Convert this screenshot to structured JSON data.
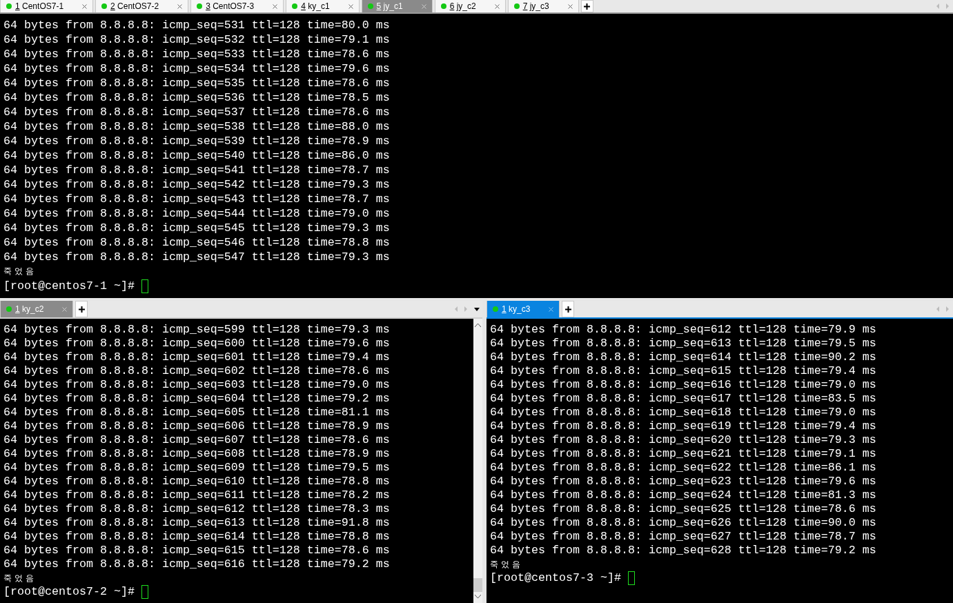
{
  "top_tabs": [
    {
      "number": "1",
      "name": "CentOS7-1",
      "selected": false,
      "connected": true
    },
    {
      "number": "2",
      "name": "CentOS7-2",
      "selected": false,
      "connected": true
    },
    {
      "number": "3",
      "name": "CentOS7-3",
      "selected": false,
      "connected": true
    },
    {
      "number": "4",
      "name": "ky_c1",
      "selected": false,
      "connected": true
    },
    {
      "number": "5",
      "name": "jy_c1",
      "selected": true,
      "connected": true
    },
    {
      "number": "6",
      "name": "jy_c2",
      "selected": false,
      "connected": true
    },
    {
      "number": "7",
      "name": "jy_c3",
      "selected": false,
      "connected": true
    }
  ],
  "top_pane": {
    "lines": [
      {
        "kind": "output",
        "text": "64 bytes from 8.8.8.8: icmp_seq=531 ttl=128 time=80.0 ms"
      },
      {
        "kind": "output",
        "text": "64 bytes from 8.8.8.8: icmp_seq=532 ttl=128 time=79.1 ms"
      },
      {
        "kind": "output",
        "text": "64 bytes from 8.8.8.8: icmp_seq=533 ttl=128 time=78.6 ms"
      },
      {
        "kind": "output",
        "text": "64 bytes from 8.8.8.8: icmp_seq=534 ttl=128 time=79.6 ms"
      },
      {
        "kind": "output",
        "text": "64 bytes from 8.8.8.8: icmp_seq=535 ttl=128 time=78.6 ms"
      },
      {
        "kind": "output",
        "text": "64 bytes from 8.8.8.8: icmp_seq=536 ttl=128 time=78.5 ms"
      },
      {
        "kind": "output",
        "text": "64 bytes from 8.8.8.8: icmp_seq=537 ttl=128 time=78.6 ms"
      },
      {
        "kind": "output",
        "text": "64 bytes from 8.8.8.8: icmp_seq=538 ttl=128 time=88.0 ms"
      },
      {
        "kind": "output",
        "text": "64 bytes from 8.8.8.8: icmp_seq=539 ttl=128 time=78.9 ms"
      },
      {
        "kind": "output",
        "text": "64 bytes from 8.8.8.8: icmp_seq=540 ttl=128 time=86.0 ms"
      },
      {
        "kind": "output",
        "text": "64 bytes from 8.8.8.8: icmp_seq=541 ttl=128 time=78.7 ms"
      },
      {
        "kind": "output",
        "text": "64 bytes from 8.8.8.8: icmp_seq=542 ttl=128 time=79.3 ms"
      },
      {
        "kind": "output",
        "text": "64 bytes from 8.8.8.8: icmp_seq=543 ttl=128 time=78.7 ms"
      },
      {
        "kind": "output",
        "text": "64 bytes from 8.8.8.8: icmp_seq=544 ttl=128 time=79.0 ms"
      },
      {
        "kind": "output",
        "text": "64 bytes from 8.8.8.8: icmp_seq=545 ttl=128 time=79.3 ms"
      },
      {
        "kind": "output",
        "text": "64 bytes from 8.8.8.8: icmp_seq=546 ttl=128 time=78.8 ms"
      },
      {
        "kind": "output",
        "text": "64 bytes from 8.8.8.8: icmp_seq=547 ttl=128 time=79.3 ms"
      },
      {
        "kind": "notice",
        "text": "죽 었 음"
      },
      {
        "kind": "prompt",
        "text": "[root@centos7-1 ~]#"
      }
    ]
  },
  "bottom_left_pane": {
    "active": false,
    "tabs": [
      {
        "number": "1",
        "name": "ky_c2",
        "selected": true,
        "connected": true
      }
    ],
    "lines": [
      {
        "kind": "output",
        "text": "64 bytes from 8.8.8.8: icmp_seq=599 ttl=128 time=79.3 ms"
      },
      {
        "kind": "output",
        "text": "64 bytes from 8.8.8.8: icmp_seq=600 ttl=128 time=79.6 ms"
      },
      {
        "kind": "output",
        "text": "64 bytes from 8.8.8.8: icmp_seq=601 ttl=128 time=79.4 ms"
      },
      {
        "kind": "output",
        "text": "64 bytes from 8.8.8.8: icmp_seq=602 ttl=128 time=78.6 ms"
      },
      {
        "kind": "output",
        "text": "64 bytes from 8.8.8.8: icmp_seq=603 ttl=128 time=79.0 ms"
      },
      {
        "kind": "output",
        "text": "64 bytes from 8.8.8.8: icmp_seq=604 ttl=128 time=79.2 ms"
      },
      {
        "kind": "output",
        "text": "64 bytes from 8.8.8.8: icmp_seq=605 ttl=128 time=81.1 ms"
      },
      {
        "kind": "output",
        "text": "64 bytes from 8.8.8.8: icmp_seq=606 ttl=128 time=78.9 ms"
      },
      {
        "kind": "output",
        "text": "64 bytes from 8.8.8.8: icmp_seq=607 ttl=128 time=78.6 ms"
      },
      {
        "kind": "output",
        "text": "64 bytes from 8.8.8.8: icmp_seq=608 ttl=128 time=78.9 ms"
      },
      {
        "kind": "output",
        "text": "64 bytes from 8.8.8.8: icmp_seq=609 ttl=128 time=79.5 ms"
      },
      {
        "kind": "output",
        "text": "64 bytes from 8.8.8.8: icmp_seq=610 ttl=128 time=78.8 ms"
      },
      {
        "kind": "output",
        "text": "64 bytes from 8.8.8.8: icmp_seq=611 ttl=128 time=78.2 ms"
      },
      {
        "kind": "output",
        "text": "64 bytes from 8.8.8.8: icmp_seq=612 ttl=128 time=78.3 ms"
      },
      {
        "kind": "output",
        "text": "64 bytes from 8.8.8.8: icmp_seq=613 ttl=128 time=91.8 ms"
      },
      {
        "kind": "output",
        "text": "64 bytes from 8.8.8.8: icmp_seq=614 ttl=128 time=78.8 ms"
      },
      {
        "kind": "output",
        "text": "64 bytes from 8.8.8.8: icmp_seq=615 ttl=128 time=78.6 ms"
      },
      {
        "kind": "output",
        "text": "64 bytes from 8.8.8.8: icmp_seq=616 ttl=128 time=79.2 ms"
      },
      {
        "kind": "notice",
        "text": "죽 었 음"
      },
      {
        "kind": "prompt",
        "text": "[root@centos7-2 ~]#"
      }
    ]
  },
  "bottom_right_pane": {
    "active": true,
    "tabs": [
      {
        "number": "1",
        "name": "ky_c3",
        "selected": true,
        "connected": true
      }
    ],
    "lines": [
      {
        "kind": "output",
        "text": "64 bytes from 8.8.8.8: icmp_seq=612 ttl=128 time=79.9 ms"
      },
      {
        "kind": "output",
        "text": "64 bytes from 8.8.8.8: icmp_seq=613 ttl=128 time=79.5 ms"
      },
      {
        "kind": "output",
        "text": "64 bytes from 8.8.8.8: icmp_seq=614 ttl=128 time=90.2 ms"
      },
      {
        "kind": "output",
        "text": "64 bytes from 8.8.8.8: icmp_seq=615 ttl=128 time=79.4 ms"
      },
      {
        "kind": "output",
        "text": "64 bytes from 8.8.8.8: icmp_seq=616 ttl=128 time=79.0 ms"
      },
      {
        "kind": "output",
        "text": "64 bytes from 8.8.8.8: icmp_seq=617 ttl=128 time=83.5 ms"
      },
      {
        "kind": "output",
        "text": "64 bytes from 8.8.8.8: icmp_seq=618 ttl=128 time=79.0 ms"
      },
      {
        "kind": "output",
        "text": "64 bytes from 8.8.8.8: icmp_seq=619 ttl=128 time=79.4 ms"
      },
      {
        "kind": "output",
        "text": "64 bytes from 8.8.8.8: icmp_seq=620 ttl=128 time=79.3 ms"
      },
      {
        "kind": "output",
        "text": "64 bytes from 8.8.8.8: icmp_seq=621 ttl=128 time=79.1 ms"
      },
      {
        "kind": "output",
        "text": "64 bytes from 8.8.8.8: icmp_seq=622 ttl=128 time=86.1 ms"
      },
      {
        "kind": "output",
        "text": "64 bytes from 8.8.8.8: icmp_seq=623 ttl=128 time=79.6 ms"
      },
      {
        "kind": "output",
        "text": "64 bytes from 8.8.8.8: icmp_seq=624 ttl=128 time=81.3 ms"
      },
      {
        "kind": "output",
        "text": "64 bytes from 8.8.8.8: icmp_seq=625 ttl=128 time=78.6 ms"
      },
      {
        "kind": "output",
        "text": "64 bytes from 8.8.8.8: icmp_seq=626 ttl=128 time=90.0 ms"
      },
      {
        "kind": "output",
        "text": "64 bytes from 8.8.8.8: icmp_seq=627 ttl=128 time=78.7 ms"
      },
      {
        "kind": "output",
        "text": "64 bytes from 8.8.8.8: icmp_seq=628 ttl=128 time=79.2 ms"
      },
      {
        "kind": "notice",
        "text": "죽 었 음"
      },
      {
        "kind": "prompt",
        "text": "[root@centos7-3 ~]#"
      }
    ]
  }
}
